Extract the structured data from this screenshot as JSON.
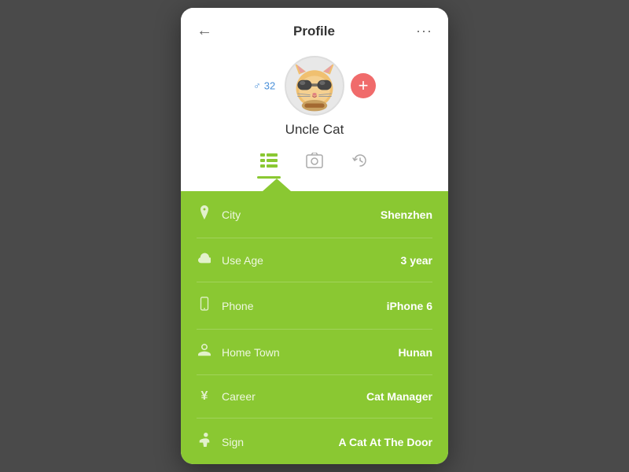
{
  "header": {
    "title": "Profile",
    "back_label": "←",
    "more_label": "···"
  },
  "profile": {
    "gender_icon": "♂",
    "age": "32",
    "name": "Uncle Cat",
    "add_button_label": "+"
  },
  "tabs": [
    {
      "id": "list",
      "label": "☰",
      "active": true
    },
    {
      "id": "photo",
      "label": "⊡",
      "active": false
    },
    {
      "id": "history",
      "label": "↺",
      "active": false
    }
  ],
  "info_items": [
    {
      "icon": "📍",
      "label": "City",
      "value": "Shenzhen"
    },
    {
      "icon": "☁",
      "label": "Use Age",
      "value": "3 year"
    },
    {
      "icon": "📱",
      "label": "Phone",
      "value": "iPhone 6"
    },
    {
      "icon": "🌿",
      "label": "Home Town",
      "value": "Hunan"
    },
    {
      "icon": "¥",
      "label": "Career",
      "value": "Cat Manager"
    },
    {
      "icon": "🔑",
      "label": "Sign",
      "value": "A Cat At The Door"
    }
  ],
  "colors": {
    "green": "#8ac832",
    "red": "#f06b6b",
    "blue": "#4a90d9"
  }
}
